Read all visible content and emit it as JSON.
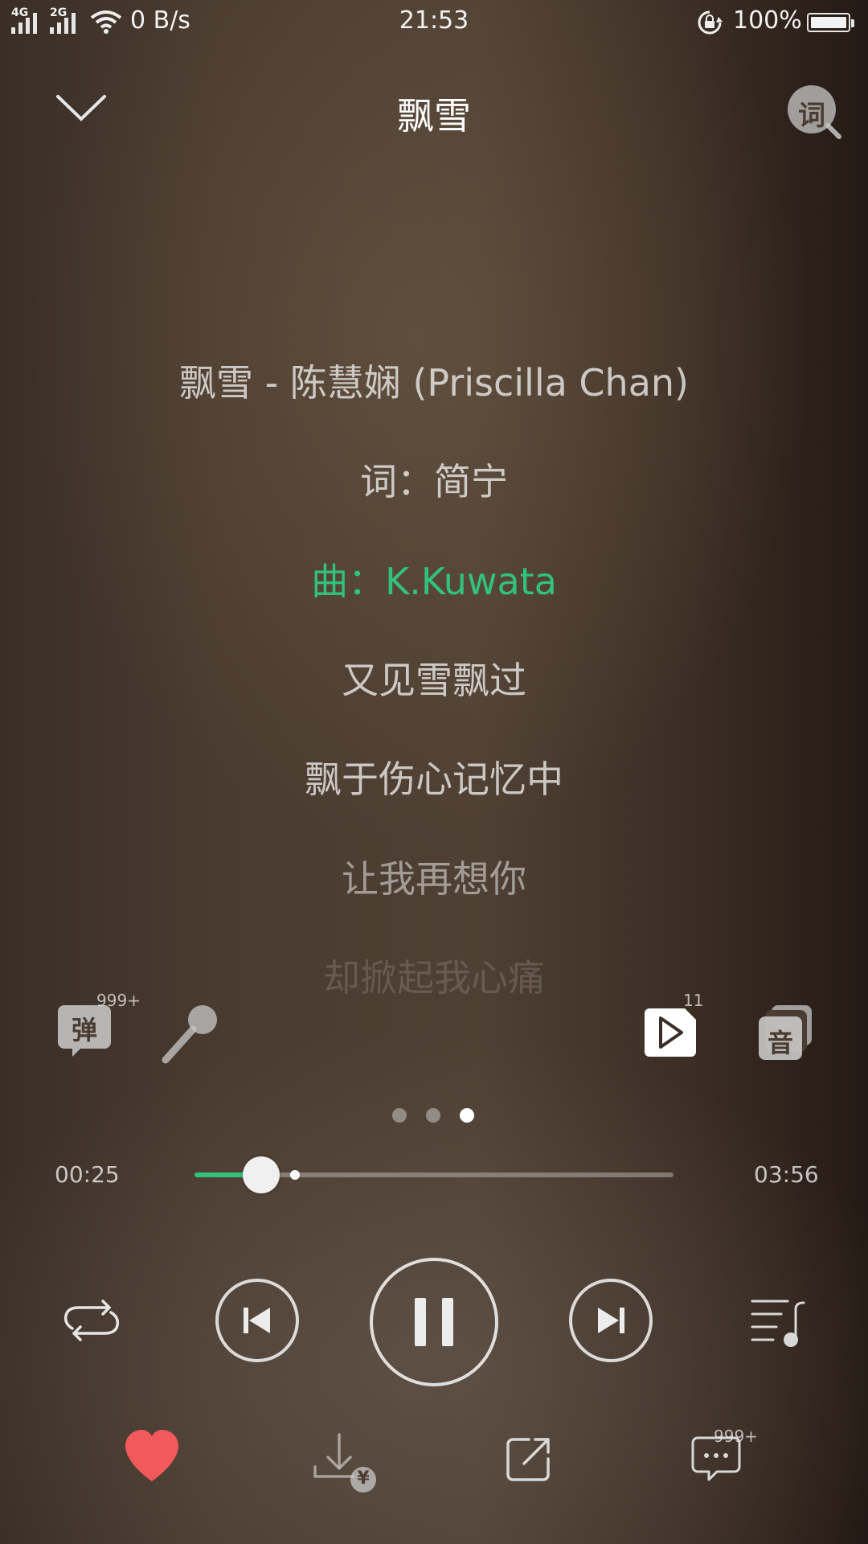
{
  "status_bar": {
    "network_1": "4G",
    "network_2": "2G",
    "net_speed": "0 B/s",
    "time": "21:53",
    "battery": "100%"
  },
  "header": {
    "title": "飘雪",
    "lyric_search_label": "词"
  },
  "lyrics": [
    {
      "text": "飘雪 - 陈慧娴 (Priscilla Chan)",
      "active": false
    },
    {
      "text": "词：简宁",
      "active": false
    },
    {
      "text": "曲：K.Kuwata",
      "active": true
    },
    {
      "text": "又见雪飘过",
      "active": false
    },
    {
      "text": "飘于伤心记忆中",
      "active": false
    },
    {
      "text": "让我再想你",
      "active": false
    },
    {
      "text": "却掀起我心痛",
      "active": false
    }
  ],
  "functions": {
    "danmu_label": "弹",
    "danmu_count": "999+",
    "mv_count": "11",
    "sound_effect_label": "音"
  },
  "pager": {
    "pages": 3,
    "active_index": 2
  },
  "progress": {
    "elapsed": "00:25",
    "total": "03:56",
    "played_fraction": 0.14,
    "buffered_fraction": 0.21
  },
  "bottom": {
    "comment_count": "999+",
    "download_price_symbol": "¥"
  },
  "colors": {
    "accent": "#31c27c",
    "like": "#f2595b"
  }
}
